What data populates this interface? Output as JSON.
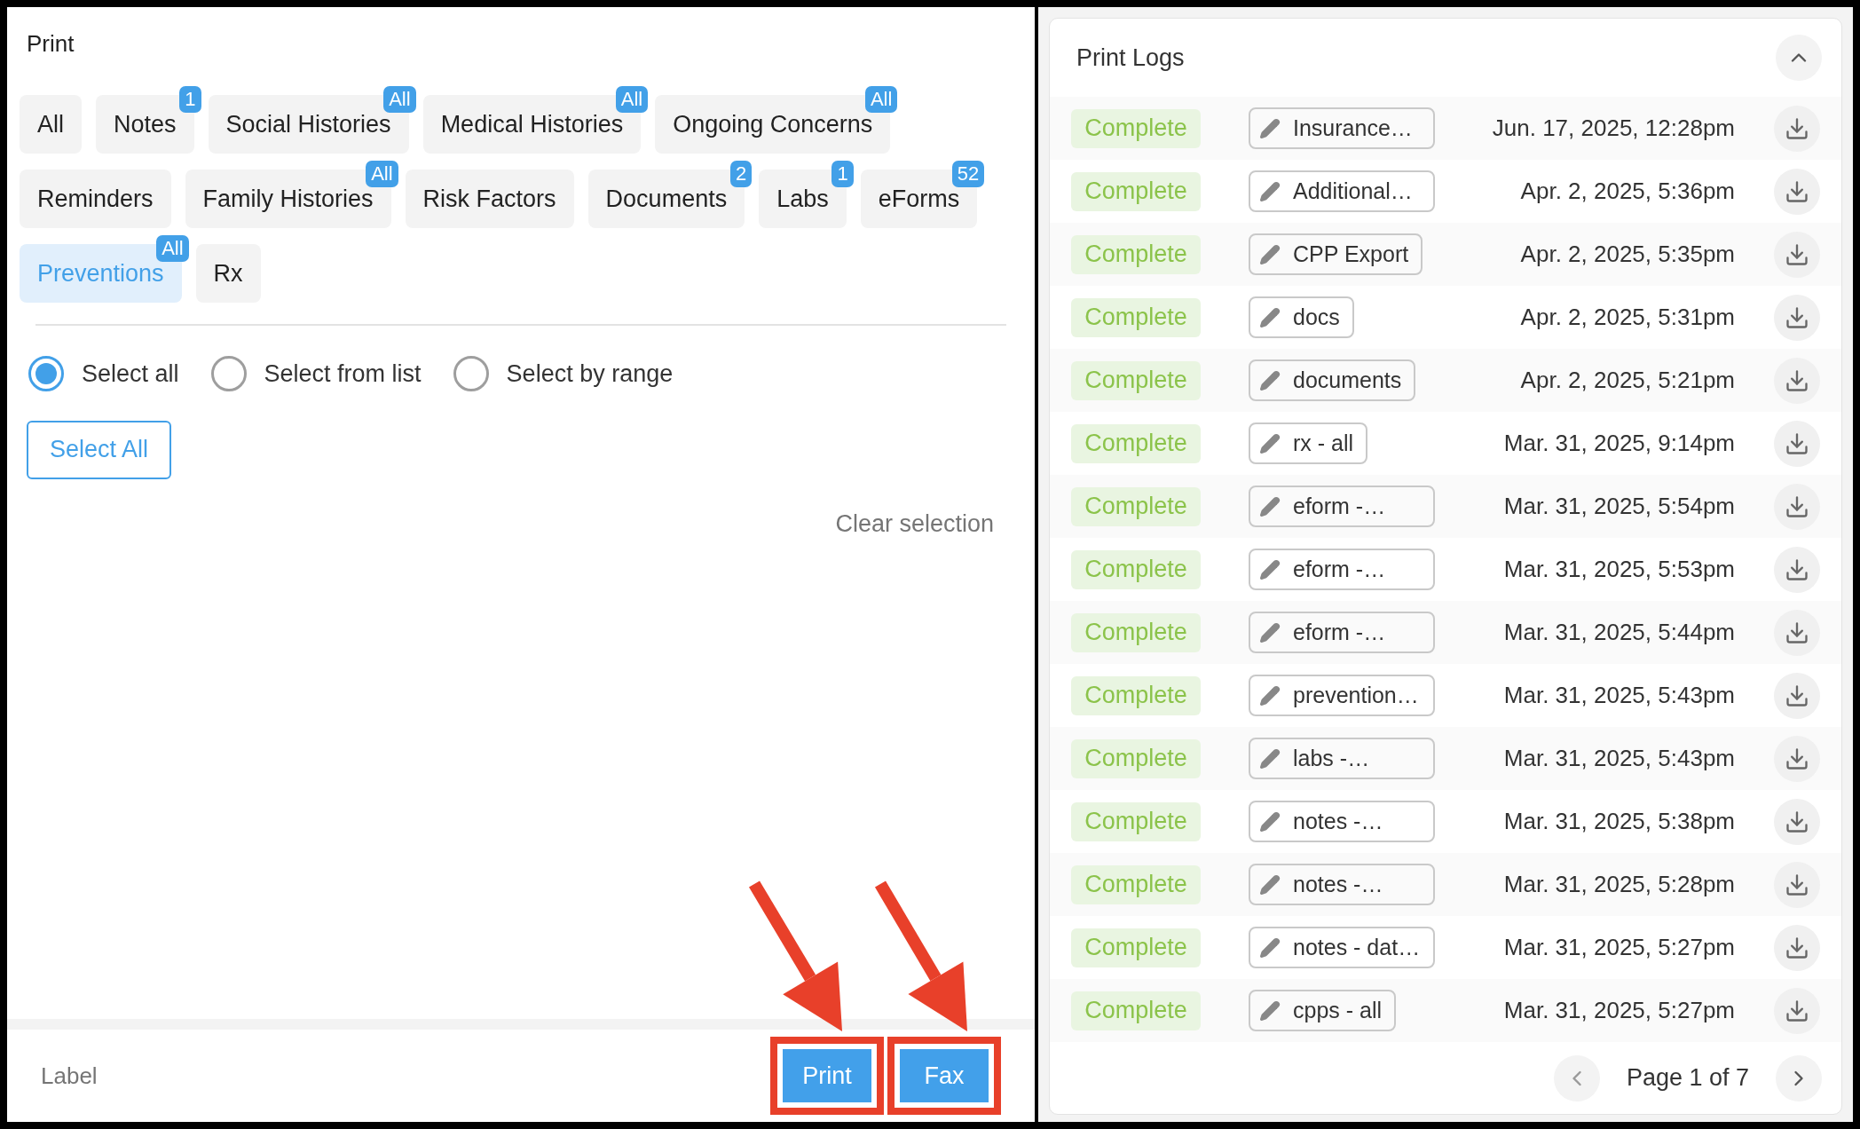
{
  "print_panel": {
    "title": "Print",
    "categories": [
      {
        "label": "All",
        "selected": false
      },
      {
        "label": "Notes",
        "selected": false,
        "badge": "1"
      },
      {
        "label": "Social Histories",
        "selected": false,
        "badge": "All"
      },
      {
        "label": "Medical Histories",
        "selected": false,
        "badge": "All"
      },
      {
        "label": "Ongoing Concerns",
        "selected": false,
        "badge": "All"
      },
      {
        "label": "Reminders",
        "selected": false
      },
      {
        "label": "Family Histories",
        "selected": false,
        "badge": "All"
      },
      {
        "label": "Risk Factors",
        "selected": false
      },
      {
        "label": "Documents",
        "selected": false,
        "badge": "2"
      },
      {
        "label": "Labs",
        "selected": false,
        "badge": "1"
      },
      {
        "label": "eForms",
        "selected": false,
        "badge": "52"
      },
      {
        "label": "Preventions",
        "selected": true,
        "badge": "All"
      },
      {
        "label": "Rx",
        "selected": false
      }
    ],
    "selection_modes": [
      {
        "label": "Select all",
        "selected": true
      },
      {
        "label": "Select from list",
        "selected": false
      },
      {
        "label": "Select by range",
        "selected": false
      }
    ],
    "select_all_button": "Select All",
    "clear_selection": "Clear selection",
    "footer": {
      "label": "Label",
      "buttons": [
        "Print",
        "Fax"
      ]
    }
  },
  "print_logs": {
    "title": "Print Logs",
    "rows": [
      {
        "status": "Complete",
        "name": "Insurance…",
        "truncated": true,
        "date": "Jun. 17, 2025, 12:28pm"
      },
      {
        "status": "Complete",
        "name": "Additional…",
        "truncated": true,
        "date": "Apr. 2, 2025, 5:36pm"
      },
      {
        "status": "Complete",
        "name": "CPP Export",
        "truncated": false,
        "date": "Apr. 2, 2025, 5:35pm"
      },
      {
        "status": "Complete",
        "name": "docs",
        "truncated": false,
        "date": "Apr. 2, 2025, 5:31pm"
      },
      {
        "status": "Complete",
        "name": "documents",
        "truncated": false,
        "date": "Apr. 2, 2025, 5:21pm"
      },
      {
        "status": "Complete",
        "name": "rx - all",
        "truncated": false,
        "date": "Mar. 31, 2025, 9:14pm"
      },
      {
        "status": "Complete",
        "name": "eform -…",
        "truncated": true,
        "date": "Mar. 31, 2025, 5:54pm"
      },
      {
        "status": "Complete",
        "name": "eform -…",
        "truncated": true,
        "date": "Mar. 31, 2025, 5:53pm"
      },
      {
        "status": "Complete",
        "name": "eform -…",
        "truncated": true,
        "date": "Mar. 31, 2025, 5:44pm"
      },
      {
        "status": "Complete",
        "name": "prevention…",
        "truncated": true,
        "date": "Mar. 31, 2025, 5:43pm"
      },
      {
        "status": "Complete",
        "name": "labs -…",
        "truncated": true,
        "date": "Mar. 31, 2025, 5:43pm"
      },
      {
        "status": "Complete",
        "name": "notes -…",
        "truncated": true,
        "date": "Mar. 31, 2025, 5:38pm"
      },
      {
        "status": "Complete",
        "name": "notes -…",
        "truncated": true,
        "date": "Mar. 31, 2025, 5:28pm"
      },
      {
        "status": "Complete",
        "name": "notes - dat…",
        "truncated": true,
        "date": "Mar. 31, 2025, 5:27pm"
      },
      {
        "status": "Complete",
        "name": "cpps - all",
        "truncated": false,
        "date": "Mar. 31, 2025, 5:27pm"
      }
    ],
    "pagination": "Page 1 of 7"
  }
}
